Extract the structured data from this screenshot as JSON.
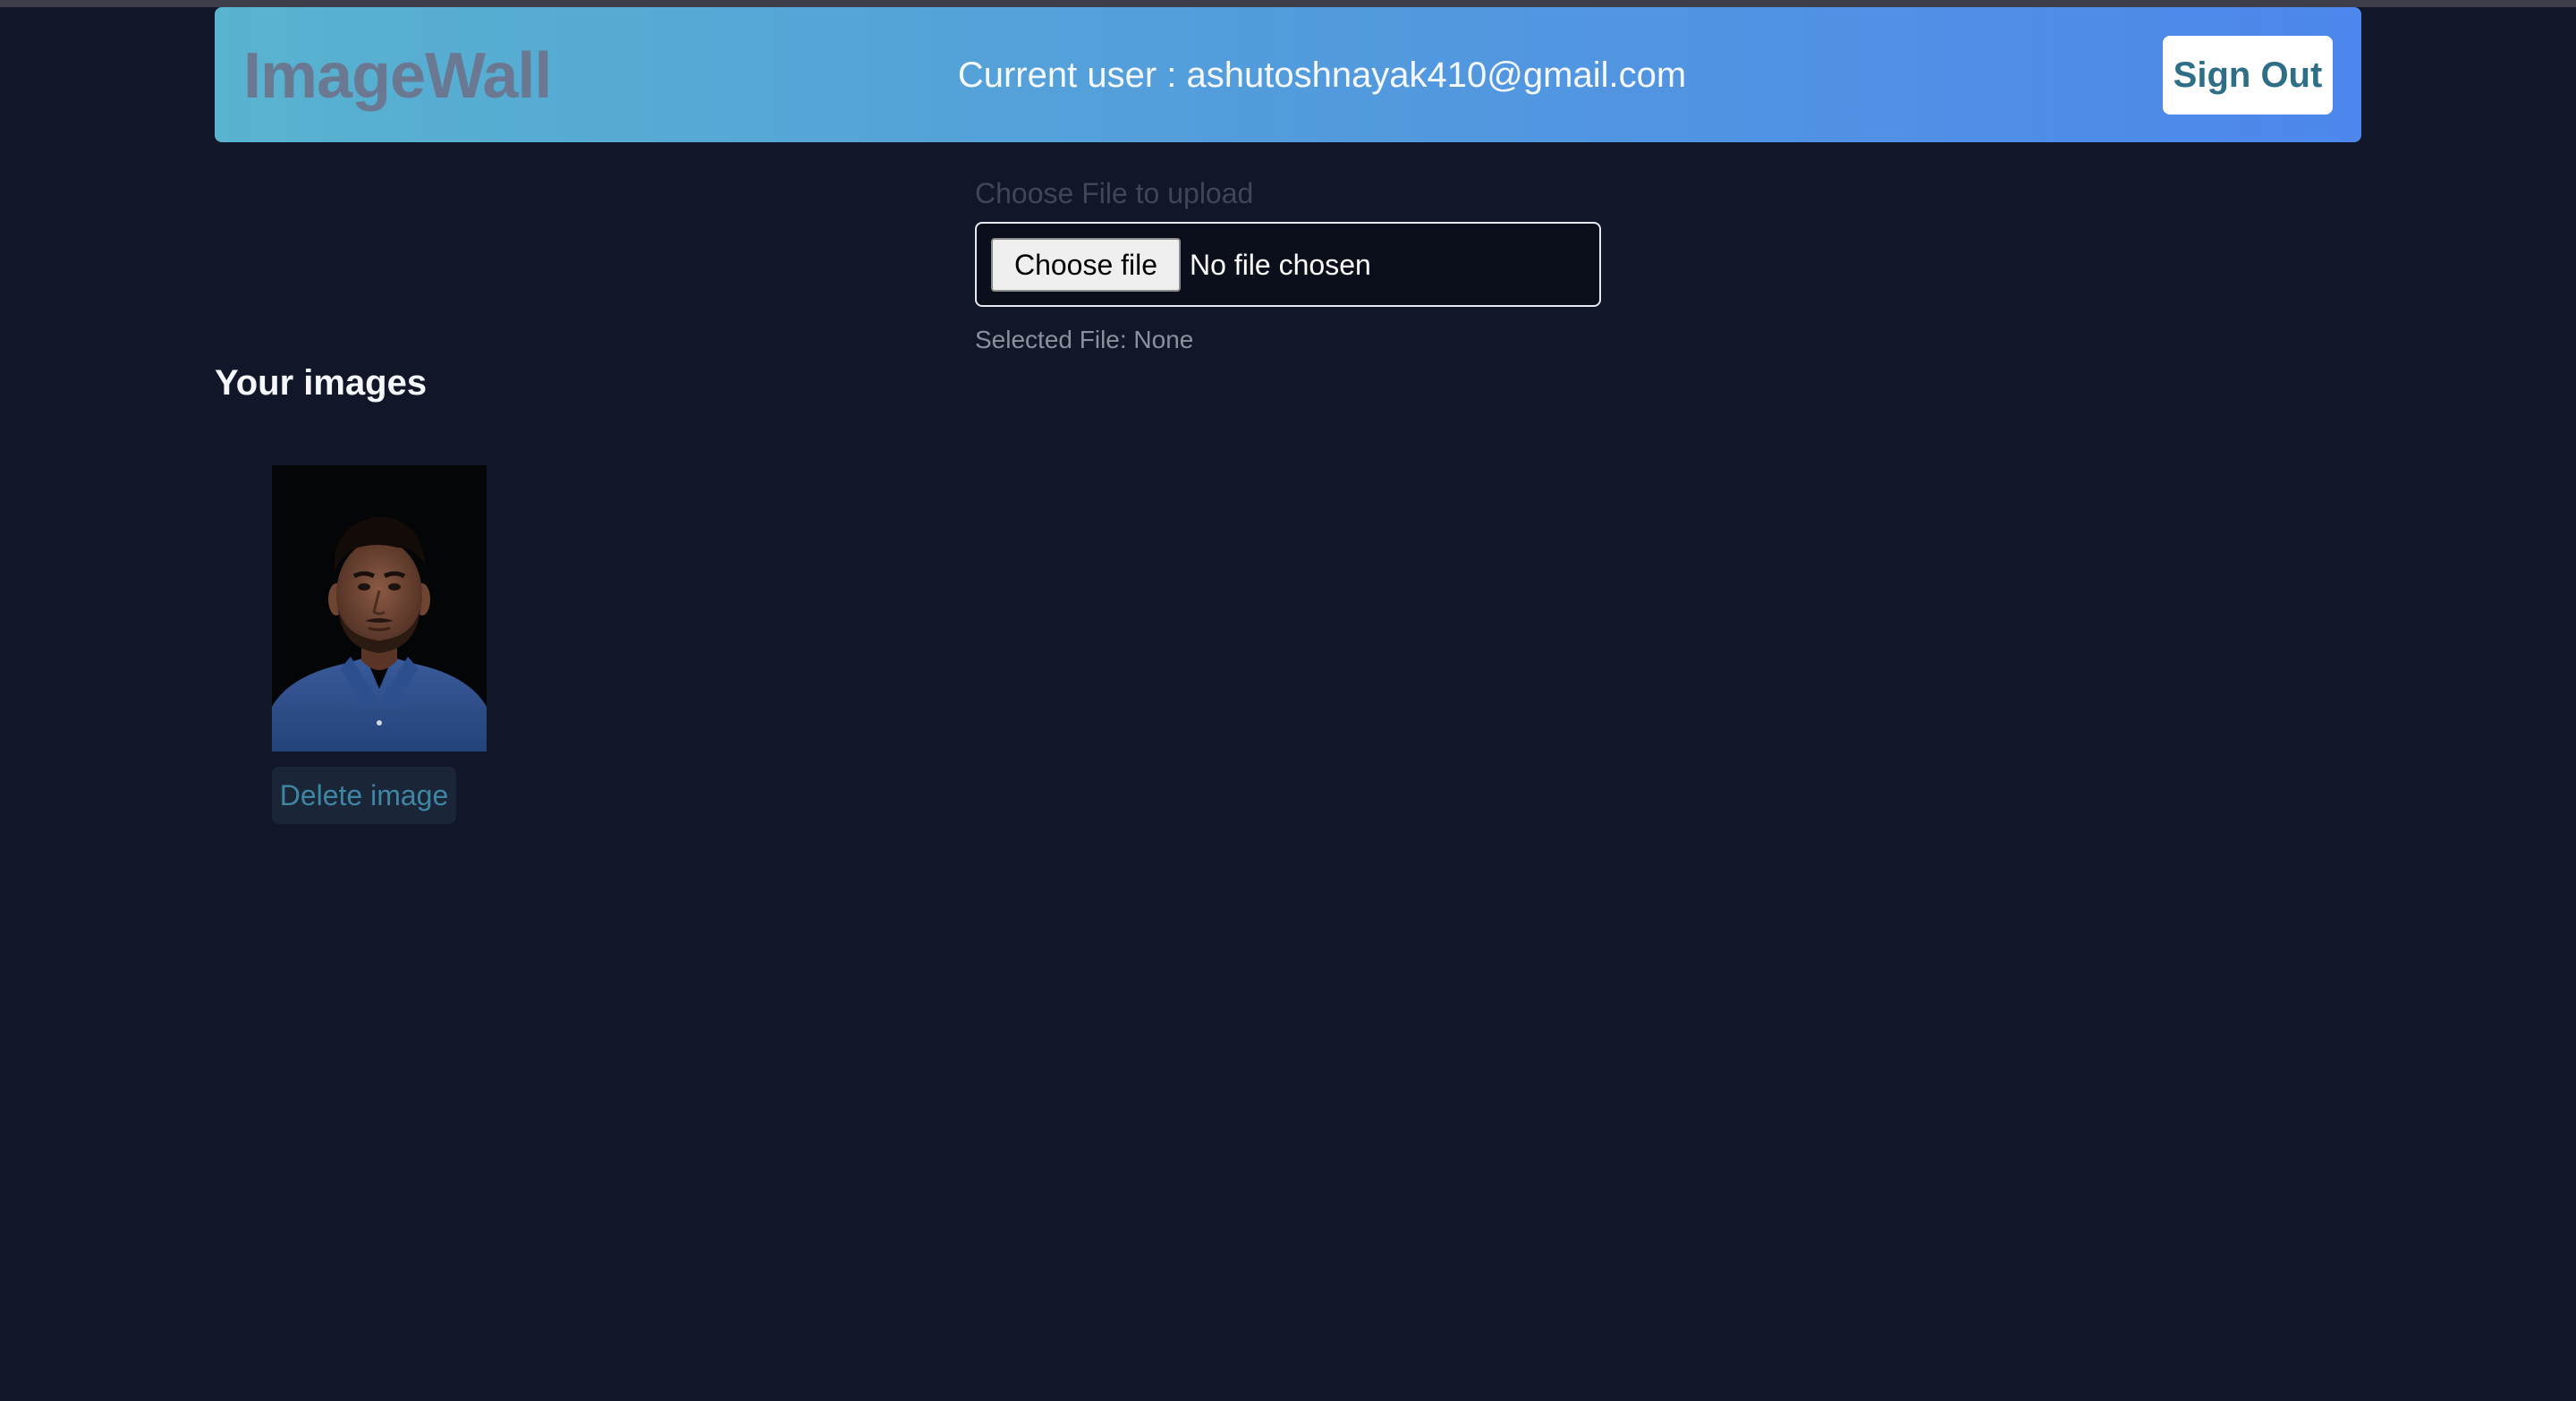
{
  "header": {
    "logo_text": "ImageWall",
    "current_user_text": "Current user : ashutoshnayak410@gmail.com",
    "sign_out_label": "Sign Out"
  },
  "upload": {
    "label": "Choose File to upload",
    "choose_button_label": "Choose file",
    "status_text": "No file chosen",
    "selected_file_text": "Selected File: None"
  },
  "gallery": {
    "title": "Your images",
    "images": [
      {
        "delete_label": "Delete image"
      }
    ]
  },
  "colors": {
    "background": "#111729",
    "header_gradient_start": "#58b3cf",
    "header_gradient_end": "#4d87ec",
    "accent": "#3f86a3"
  }
}
